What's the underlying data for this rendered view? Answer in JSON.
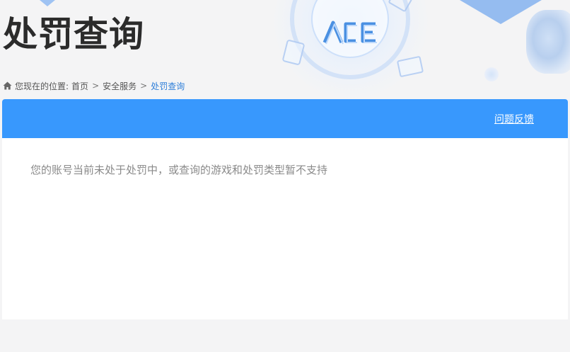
{
  "header": {
    "title": "处罚查询",
    "logo_text": "ACE",
    "icons": [
      "home-icon",
      "ace-logo",
      "game-controller-tag"
    ]
  },
  "breadcrumb": {
    "prefix": "您现在的位置:",
    "items": [
      "首页",
      "安全服务",
      "处罚查询"
    ],
    "separator": ">"
  },
  "panel": {
    "feedback_label": "问题反馈",
    "message": "您的账号当前未处于处罚中，或查询的游戏和处罚类型暂不支持"
  },
  "colors": {
    "accent": "#3898fd",
    "link_current": "#2f7fd9",
    "title": "#2b2b2b",
    "background": "#f4f4f5"
  }
}
